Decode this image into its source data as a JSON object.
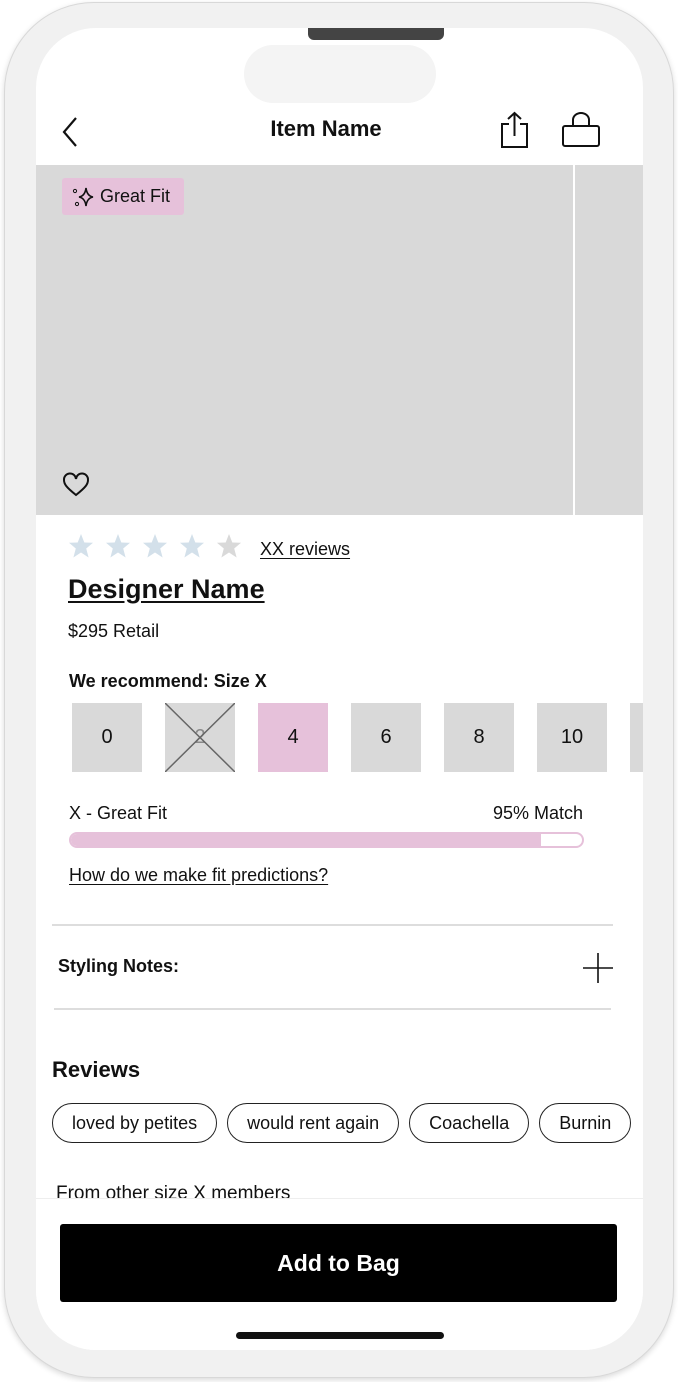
{
  "header": {
    "title": "Item Name",
    "back_icon": "chevron-left-icon",
    "share_icon": "share-icon",
    "bag_icon": "shopping-bag-icon"
  },
  "hero": {
    "badge": "Great Fit",
    "badge_icon": "sparkle-icon",
    "favorite_icon": "heart-icon"
  },
  "rating": {
    "stars_filled": 4,
    "stars_total": 5,
    "reviews_link": "XX reviews"
  },
  "product": {
    "designer": "Designer Name",
    "price": "$295 Retail"
  },
  "sizing": {
    "recommend_label": "We recommend: Size X",
    "sizes": [
      {
        "label": "0",
        "state": "available"
      },
      {
        "label": "2",
        "state": "unavailable"
      },
      {
        "label": "4",
        "state": "selected"
      },
      {
        "label": "6",
        "state": "available"
      },
      {
        "label": "8",
        "state": "available"
      },
      {
        "label": "10",
        "state": "available"
      },
      {
        "label": "",
        "state": "available"
      }
    ],
    "fit_label": "X - Great Fit",
    "match_label": "95% Match",
    "match_fill_percent": 92,
    "fit_link": "How do we make fit predictions?"
  },
  "styling": {
    "label": "Styling Notes:"
  },
  "reviews": {
    "title": "Reviews",
    "chips": [
      "loved by petites",
      "would rent again",
      "Coachella",
      "Burnin"
    ],
    "subtitle": "From other size X members"
  },
  "cta": {
    "label": "Add to Bag"
  },
  "colors": {
    "accent": "#e6c1da",
    "star_filled": "#d3e0ea",
    "star_empty": "#d9d9d9"
  }
}
